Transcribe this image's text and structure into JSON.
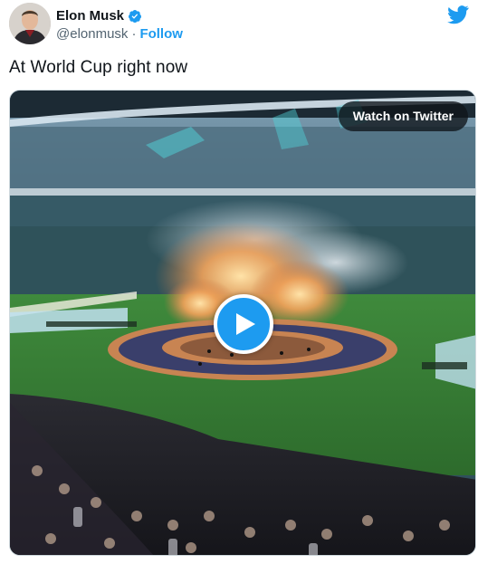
{
  "user": {
    "display_name": "Elon Musk",
    "handle": "@elonmusk",
    "separator": "·",
    "follow_label": "Follow"
  },
  "tweet": {
    "text": "At World Cup right now"
  },
  "media": {
    "watch_label": "Watch on Twitter"
  },
  "colors": {
    "accent": "#1d9bf0",
    "handle": "#536471",
    "text": "#0f1419"
  },
  "icons": {
    "brand": "twitter-bird-icon",
    "verified": "verified-badge-icon",
    "play": "play-icon"
  }
}
